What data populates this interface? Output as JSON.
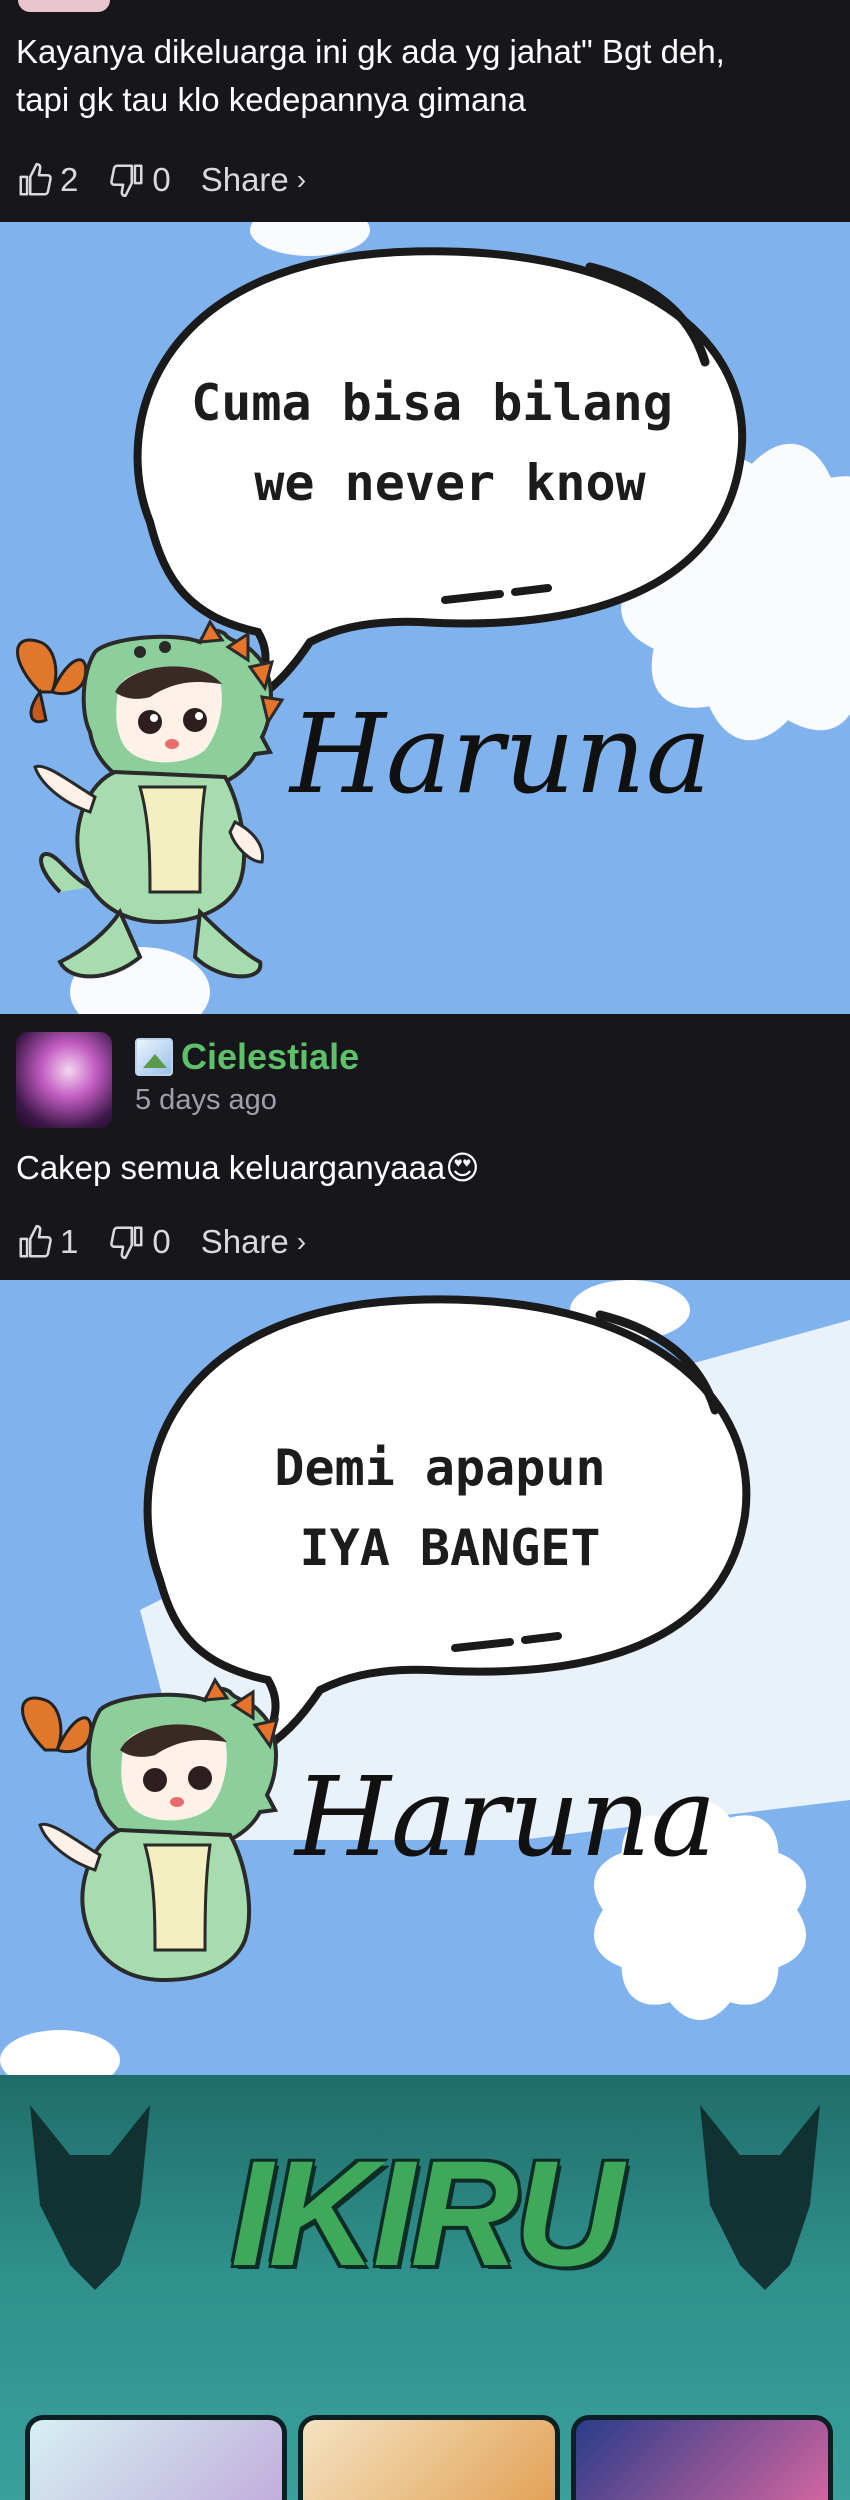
{
  "comment_top": {
    "text": "Kayanya dikeluarga ini gk ada yg jahat\" Bgt deh,\ntapi gk tau klo kedepannya gimana",
    "likes": "2",
    "dislikes": "0",
    "share_label": "Share",
    "share_chevron": "›"
  },
  "banner_1": {
    "line1": "Cuma bisa bilang",
    "line2": "we never know",
    "signature": "Haruna"
  },
  "comment_2": {
    "username": "Cielestiale",
    "time": "5 days ago",
    "text": "Cakep semua keluarganyaaa😍",
    "likes": "1",
    "dislikes": "0",
    "share_label": "Share",
    "share_chevron": "›"
  },
  "banner_2": {
    "line1": "Demi apapun",
    "line2": "IYA BANGET",
    "signature": "Haruna"
  },
  "ikiru": {
    "title": "IKIRU"
  },
  "colors": {
    "background": "#16161b",
    "username": "#5fc06a",
    "banner_blue": "#80b3ee",
    "ikiru_teal": "#2f8f8b"
  }
}
